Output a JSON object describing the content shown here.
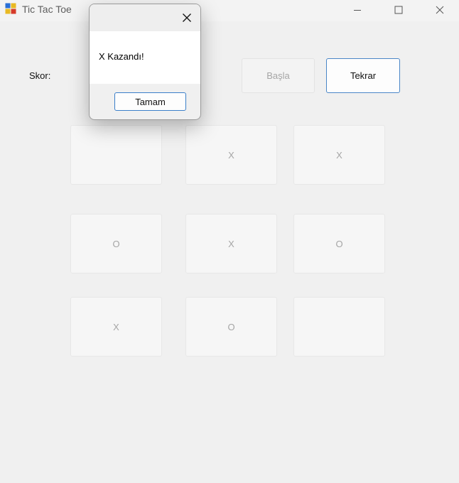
{
  "window": {
    "title": "Tic Tac Toe"
  },
  "score": {
    "label": "Skor:"
  },
  "buttons": {
    "start_label": "Başla",
    "start_enabled": false,
    "again_label": "Tekrar"
  },
  "board": {
    "cells": [
      "",
      "X",
      "X",
      "O",
      "X",
      "O",
      "X",
      "O",
      ""
    ]
  },
  "message_box": {
    "message": "X Kazandı!",
    "ok_label": "Tamam"
  },
  "colors": {
    "background": "#f0f0f0",
    "accent": "#3b7fc9",
    "cell_background": "#f6f6f6",
    "disabled_text": "#a5a5a5"
  }
}
